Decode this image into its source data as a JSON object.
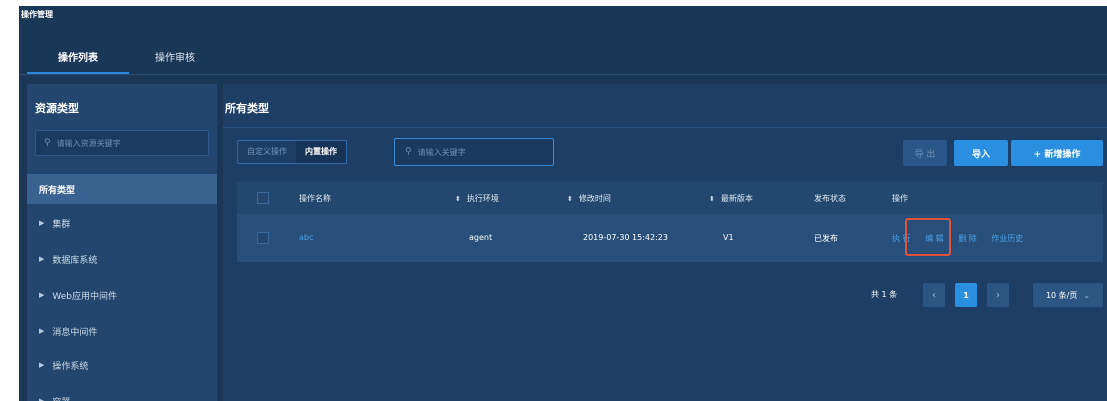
{
  "page_title": "操作管理",
  "tabs": [
    {
      "label": "操作列表",
      "active": true
    },
    {
      "label": "操作审核",
      "active": false
    }
  ],
  "sidebar": {
    "title": "资源类型",
    "search_placeholder": "请输入资源关键字",
    "items": [
      {
        "label": "所有类型",
        "active": true,
        "expandable": false
      },
      {
        "label": "集群",
        "expandable": true
      },
      {
        "label": "数据库系统",
        "expandable": true
      },
      {
        "label": "Web应用中间件",
        "expandable": true
      },
      {
        "label": "消息中间件",
        "expandable": true
      },
      {
        "label": "操作系统",
        "expandable": true
      },
      {
        "label": "容器",
        "expandable": true
      }
    ]
  },
  "main": {
    "title": "所有类型",
    "filter_tabs": [
      {
        "label": "自定义操作",
        "active": false
      },
      {
        "label": "内置操作",
        "active": true
      }
    ],
    "search_placeholder": "请输入关键字",
    "buttons": {
      "export": "导 出",
      "import": "导入",
      "new": "+ 新增操作"
    },
    "table": {
      "columns": [
        "操作名称",
        "执行环境",
        "修改时间",
        "最新版本",
        "发布状态",
        "操作"
      ],
      "rows": [
        {
          "name": "abc",
          "env": "agent",
          "modified": "2019-07-30 15:42:23",
          "version": "V1",
          "status": "已发布",
          "actions": [
            "执 行",
            "编 辑",
            "删 除",
            "作业历史"
          ]
        }
      ]
    },
    "pagination": {
      "total": "共 1 条",
      "current_page": "1",
      "page_size": "10 条/页"
    }
  },
  "colors": {
    "background": "#1b3758",
    "accent": "#2a8fe0",
    "link": "#4ea0ea",
    "highlight": "#e0533a"
  }
}
